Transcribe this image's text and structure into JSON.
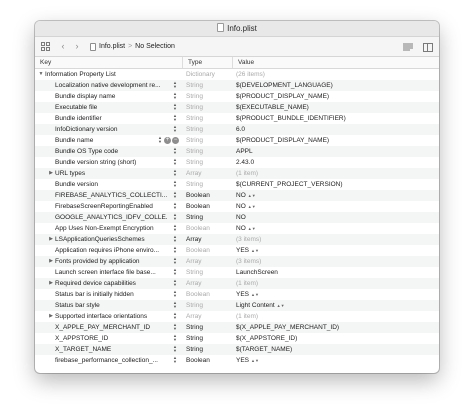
{
  "window": {
    "title": "Info.plist"
  },
  "pathbar": {
    "file": "Info.plist",
    "separator": ">",
    "selection": "No Selection"
  },
  "columns": {
    "key": "Key",
    "type": "Type",
    "value": "Value"
  },
  "rows": [
    {
      "key": "Information Property List",
      "type": "Dictionary",
      "value": "(26 items)",
      "indent": 0,
      "disclosure": "open",
      "muted": true
    },
    {
      "key": "Localization native development re...",
      "type": "String",
      "value": "$(DEVELOPMENT_LANGUAGE)",
      "indent": 1,
      "muted": true
    },
    {
      "key": "Bundle display name",
      "type": "String",
      "value": "$(PRODUCT_DISPLAY_NAME)",
      "indent": 1,
      "muted": true
    },
    {
      "key": "Executable file",
      "type": "String",
      "value": "$(EXECUTABLE_NAME)",
      "indent": 1,
      "muted": true
    },
    {
      "key": "Bundle identifier",
      "type": "String",
      "value": "$(PRODUCT_BUNDLE_IDENTIFIER)",
      "indent": 1,
      "muted": true
    },
    {
      "key": "InfoDictionary version",
      "type": "String",
      "value": "6.0",
      "indent": 1,
      "muted": true
    },
    {
      "key": "Bundle name",
      "type": "String",
      "value": "$(PRODUCT_DISPLAY_NAME)",
      "indent": 1,
      "muted": true,
      "controls": true
    },
    {
      "key": "Bundle OS Type code",
      "type": "String",
      "value": "APPL",
      "indent": 1,
      "muted": true
    },
    {
      "key": "Bundle version string (short)",
      "type": "String",
      "value": "2.43.0",
      "indent": 1,
      "muted": true
    },
    {
      "key": "URL types",
      "type": "Array",
      "value": "(1 item)",
      "indent": 1,
      "disclosure": "closed",
      "muted": true
    },
    {
      "key": "Bundle version",
      "type": "String",
      "value": "$(CURRENT_PROJECT_VERSION)",
      "indent": 1,
      "muted": true
    },
    {
      "key": "FIREBASE_ANALYTICS_COLLECTI...",
      "type": "Boolean",
      "value": "NO",
      "indent": 1,
      "muted": false,
      "selectArrows": true
    },
    {
      "key": "FirebaseScreenReportingEnabled",
      "type": "Boolean",
      "value": "NO",
      "indent": 1,
      "muted": false,
      "selectArrows": true
    },
    {
      "key": "GOOGLE_ANALYTICS_IDFV_COLLE...",
      "type": "String",
      "value": "NO",
      "indent": 1,
      "muted": false
    },
    {
      "key": "App Uses Non-Exempt Encryption",
      "type": "Boolean",
      "value": "NO",
      "indent": 1,
      "muted": true,
      "selectArrows": true
    },
    {
      "key": "LSApplicationQueriesSchemes",
      "type": "Array",
      "value": "(3 items)",
      "indent": 1,
      "disclosure": "closed",
      "muted": false
    },
    {
      "key": "Application requires iPhone enviro...",
      "type": "Boolean",
      "value": "YES",
      "indent": 1,
      "muted": true,
      "selectArrows": true
    },
    {
      "key": "Fonts provided by application",
      "type": "Array",
      "value": "(3 items)",
      "indent": 1,
      "disclosure": "closed",
      "muted": true
    },
    {
      "key": "Launch screen interface file base...",
      "type": "String",
      "value": "LaunchScreen",
      "indent": 1,
      "muted": true
    },
    {
      "key": "Required device capabilities",
      "type": "Array",
      "value": "(1 item)",
      "indent": 1,
      "disclosure": "closed",
      "muted": true
    },
    {
      "key": "Status bar is initially hidden",
      "type": "Boolean",
      "value": "YES",
      "indent": 1,
      "muted": true,
      "selectArrows": true
    },
    {
      "key": "Status bar style",
      "type": "String",
      "value": "Light Content",
      "indent": 1,
      "muted": true,
      "selectArrows": true
    },
    {
      "key": "Supported interface orientations",
      "type": "Array",
      "value": "(1 item)",
      "indent": 1,
      "disclosure": "closed",
      "muted": true
    },
    {
      "key": "X_APPLE_PAY_MERCHANT_ID",
      "type": "String",
      "value": "$(X_APPLE_PAY_MERCHANT_ID)",
      "indent": 1,
      "muted": false
    },
    {
      "key": "X_APPSTORE_ID",
      "type": "String",
      "value": "$(X_APPSTORE_ID)",
      "indent": 1,
      "muted": false
    },
    {
      "key": "X_TARGET_NAME",
      "type": "String",
      "value": "$(TARGET_NAME)",
      "indent": 1,
      "muted": false
    },
    {
      "key": "firebase_performance_collection_...",
      "type": "Boolean",
      "value": "YES",
      "indent": 1,
      "muted": false,
      "selectArrows": true
    }
  ]
}
